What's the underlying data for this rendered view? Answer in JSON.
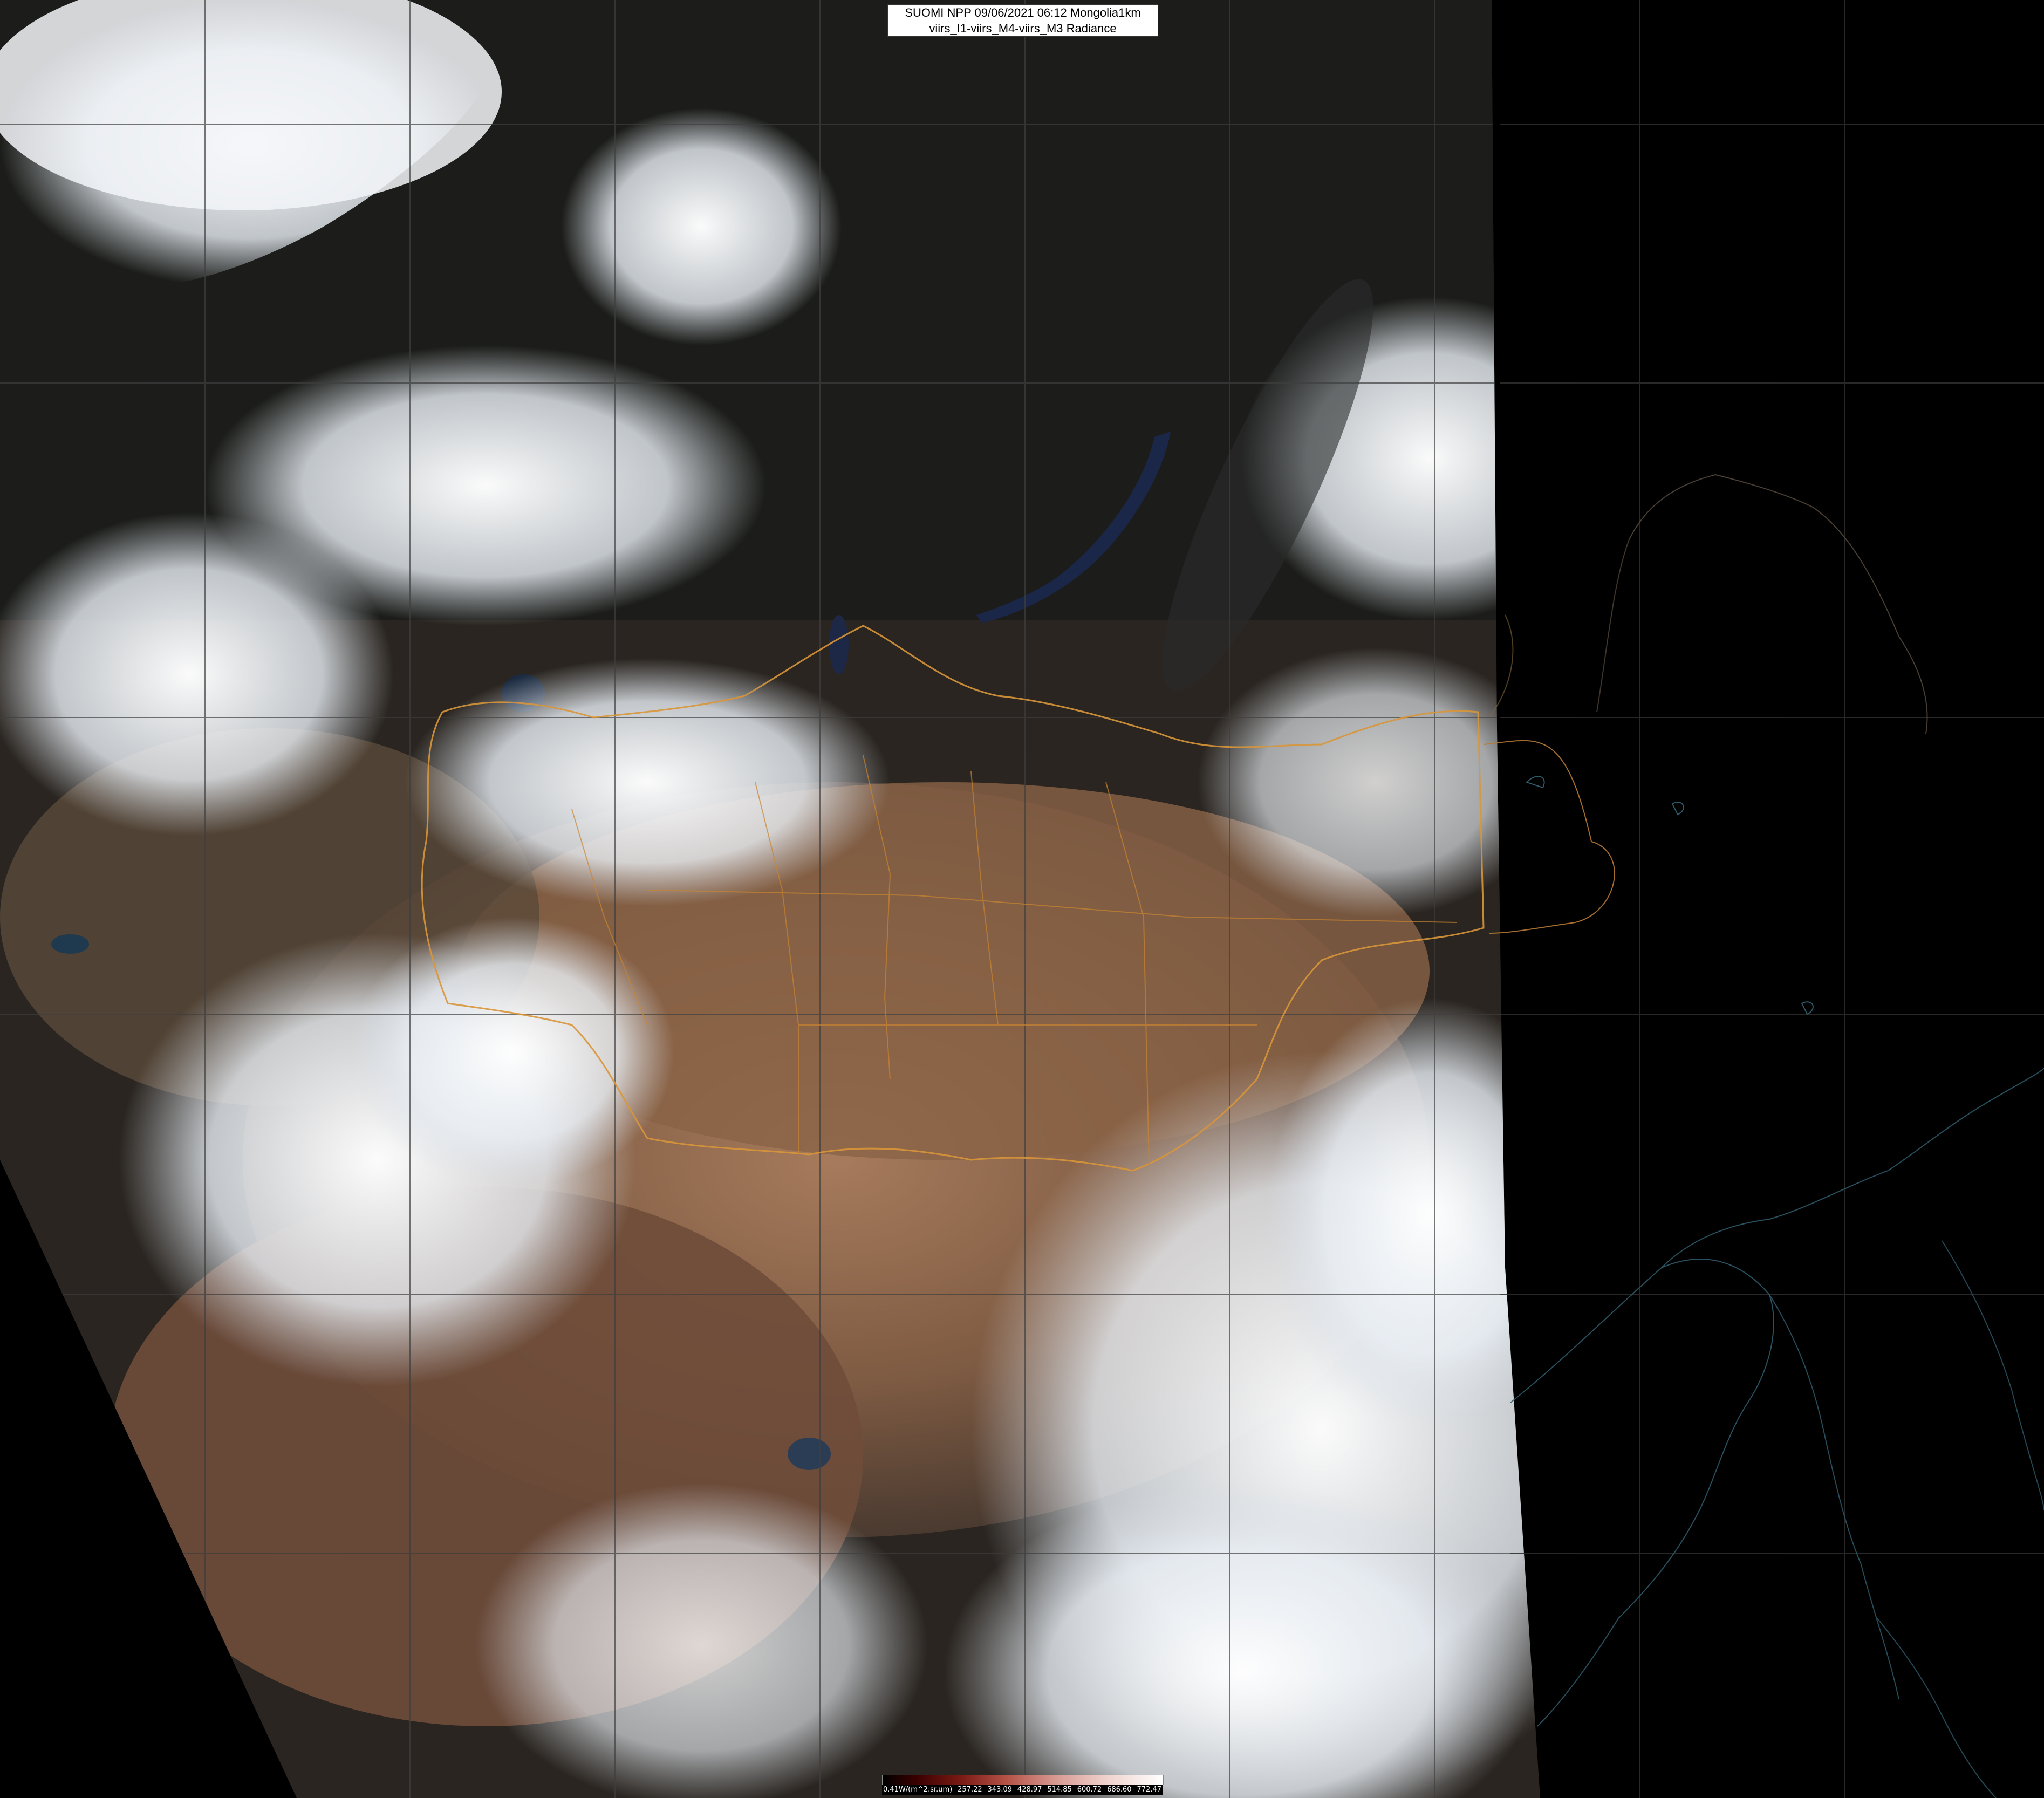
{
  "title": {
    "line1": "SUOMI NPP 09/06/2021 06:12 Mongolia1km",
    "line2": "viirs_I1-viirs_M4-viirs_M3 Radiance"
  },
  "colorbar": {
    "labels": [
      "0.41W/(m^2.sr.um)",
      "257.22",
      "343.09",
      "428.97",
      "514.85",
      "600.72",
      "686.60",
      "772.47"
    ]
  },
  "colors": {
    "background": "#000000",
    "land_desert": "#8a6a4f",
    "land_dark": "#2b2520",
    "clouds": "#eef3f7",
    "boundary": "#d8963a",
    "coastline": "#2e5a6a",
    "graticule": "#3a3a3a",
    "water": "#1c2a4a"
  }
}
